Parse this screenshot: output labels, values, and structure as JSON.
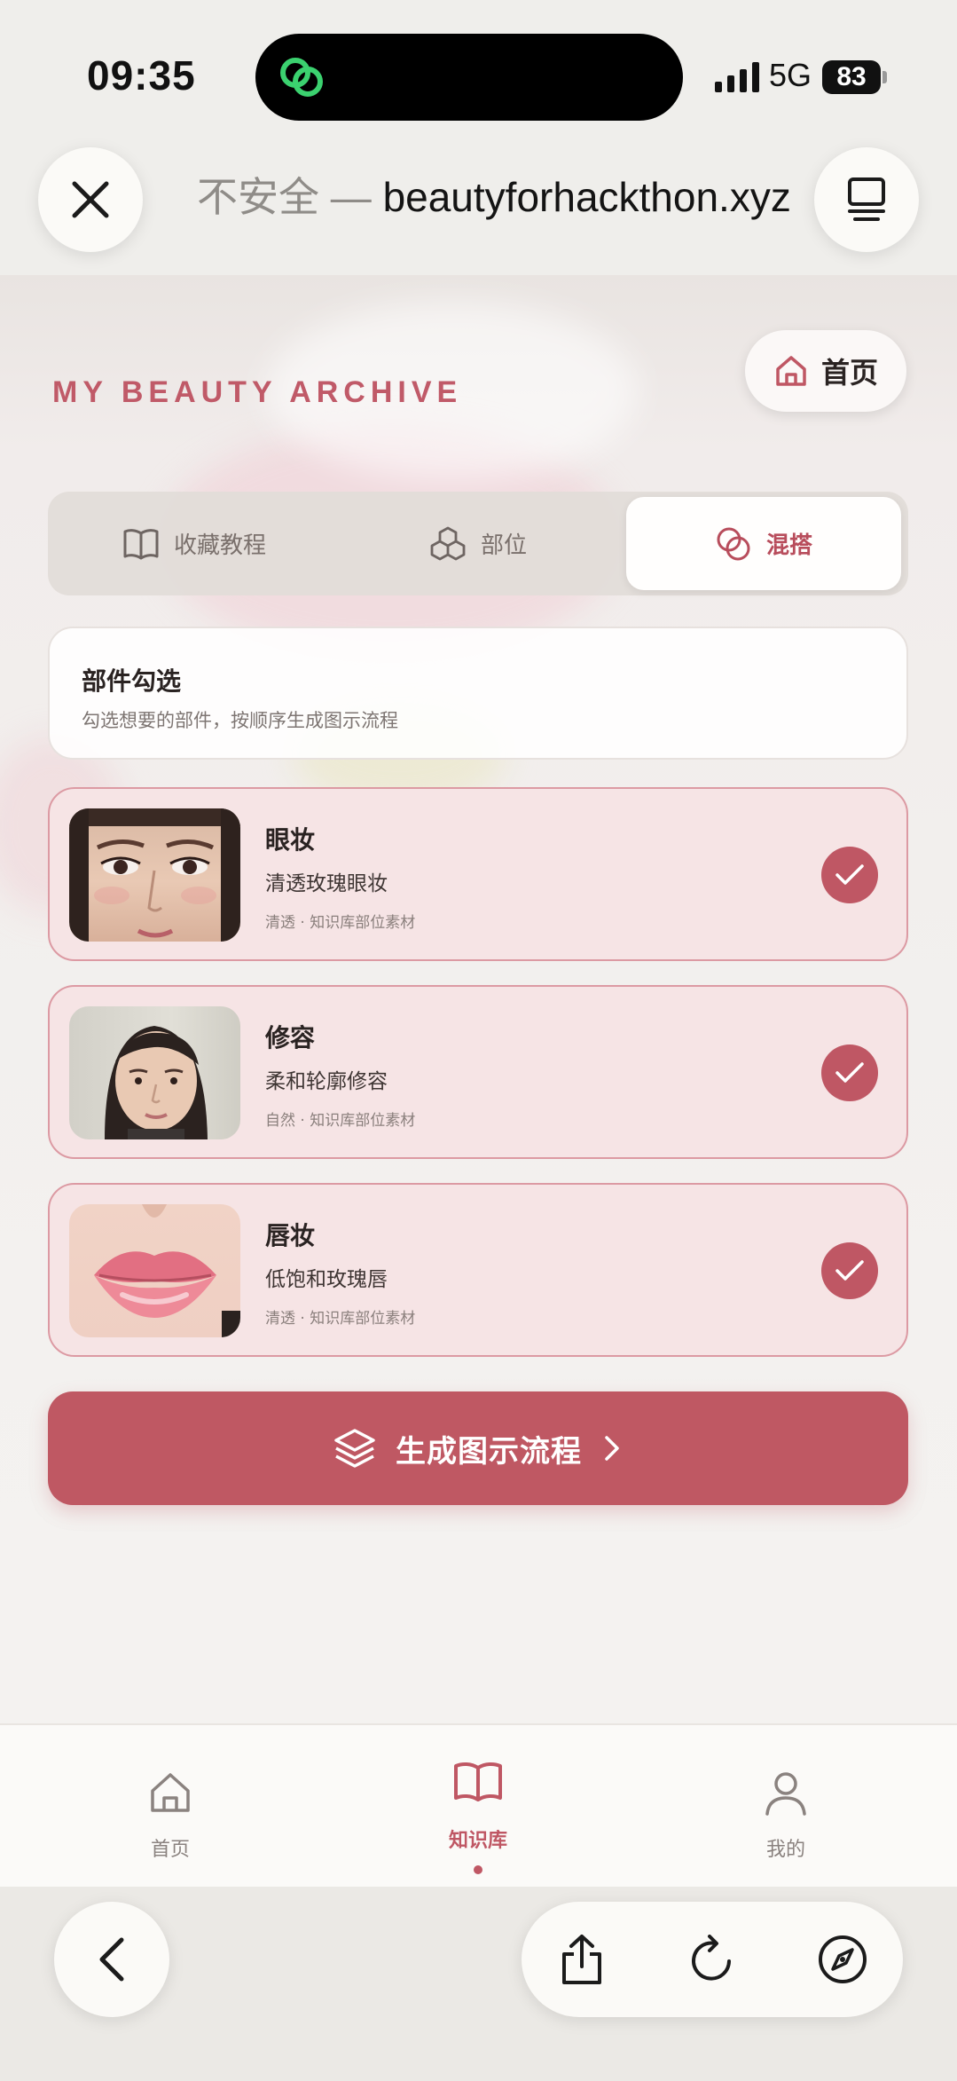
{
  "status_bar": {
    "time": "09:35",
    "network": "5G",
    "battery": "83"
  },
  "browser": {
    "url_insecure": "不安全 — ",
    "url_host": "beautyforhackthon.xyz"
  },
  "page": {
    "heading": "MY BEAUTY ARCHIVE",
    "home_button": "首页",
    "segments": [
      {
        "label": "收藏教程",
        "icon": "book-icon"
      },
      {
        "label": "部位",
        "icon": "cubes-icon"
      },
      {
        "label": "混搭",
        "icon": "overlap-circles-icon",
        "active": true
      }
    ],
    "info": {
      "title": "部件勾选",
      "description": "勾选想要的部件，按顺序生成图示流程"
    },
    "parts": [
      {
        "name": "眼妆",
        "style": "清透玫瑰眼妆",
        "meta": "清透 · 知识库部位素材",
        "checked": true
      },
      {
        "name": "修容",
        "style": "柔和轮廓修容",
        "meta": "自然 · 知识库部位素材",
        "checked": true
      },
      {
        "name": "唇妆",
        "style": "低饱和玫瑰唇",
        "meta": "清透 · 知识库部位素材",
        "checked": true
      }
    ],
    "generate_button": "生成图示流程"
  },
  "tabbar": {
    "items": [
      {
        "label": "首页",
        "icon": "home-icon"
      },
      {
        "label": "知识库",
        "icon": "book-icon",
        "active": true
      },
      {
        "label": "我的",
        "icon": "user-icon"
      }
    ]
  },
  "colors": {
    "accent": "#bf5764",
    "card_bg": "#f6e4e5",
    "card_border": "#dc9aa3"
  }
}
